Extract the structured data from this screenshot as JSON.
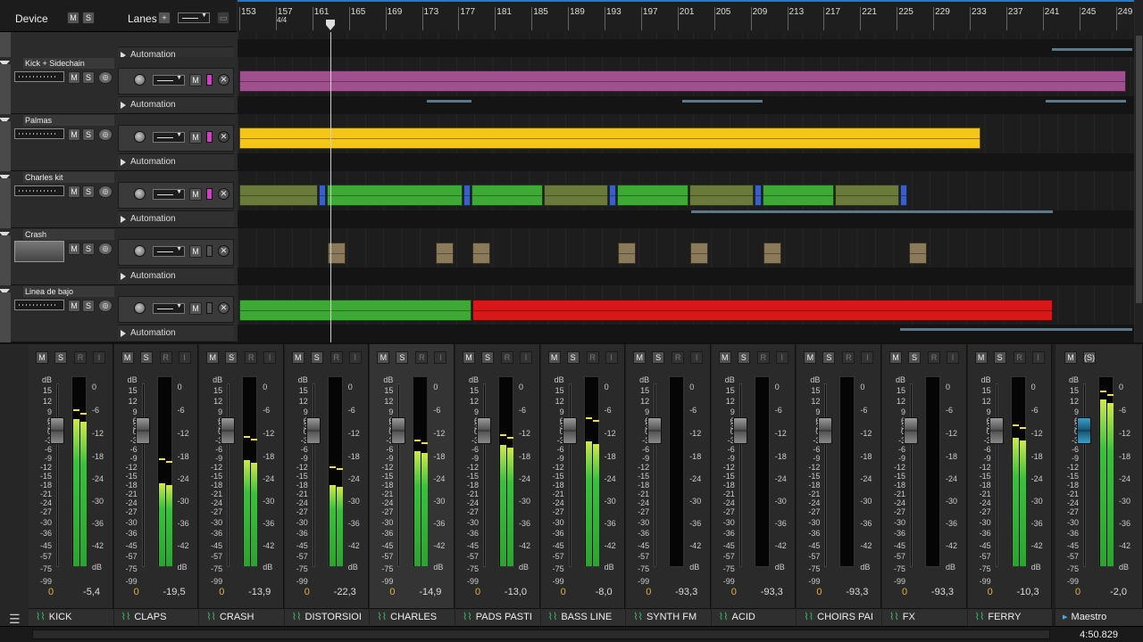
{
  "header": {
    "device_label": "Device",
    "m": "M",
    "s": "S",
    "lanes_label": "Lanes",
    "add": "+"
  },
  "ruler": {
    "time_signature": "4/4",
    "bars": [
      "153",
      "157",
      "161",
      "165",
      "169",
      "173",
      "177",
      "181",
      "185",
      "189",
      "193",
      "197",
      "201",
      "205",
      "209",
      "213",
      "217",
      "221",
      "225",
      "229",
      "233",
      "237",
      "241",
      "245",
      "249"
    ]
  },
  "tracks": [
    {
      "name": "",
      "automation": "Automation"
    },
    {
      "name": "Kick + Sidechain",
      "automation": "Automation"
    },
    {
      "name": "Palmas",
      "automation": "Automation"
    },
    {
      "name": "Charles kit",
      "automation": "Automation"
    },
    {
      "name": "Crash",
      "automation": "Automation"
    },
    {
      "name": "Linea de bajo",
      "automation": "Automation"
    }
  ],
  "colors": {
    "kick_clip": "#a0508f",
    "palmas_clip": "#f5c518",
    "charles_clip": "#3caa35",
    "charles_clip_alt": "#6a7a3a",
    "charles_marker": "#3a5fc8",
    "crash_clip": "#8a7a5a",
    "bajo_green": "#3caa35",
    "bajo_red": "#d81818",
    "meter_green": "#2aa530",
    "accent_blue": "#2a7ac0"
  },
  "mixer": {
    "msri": {
      "m": "M",
      "s": "S",
      "r": "R",
      "i": "I"
    },
    "scale_db_label": "dB",
    "left_scale": [
      "dB",
      "15",
      "12",
      "9",
      "6",
      "3",
      "0",
      "-3",
      "-6",
      "-9",
      "-12",
      "-15",
      "-18",
      "-21",
      "-24",
      "-27",
      "-30",
      "-36",
      "-45",
      "-57",
      "-75",
      "-99"
    ],
    "right_scale": [
      "0",
      "-6",
      "-12",
      "-18",
      "-24",
      "-30",
      "-36",
      "-42",
      "dB"
    ],
    "channels": [
      {
        "name": "KICK",
        "pan": "0",
        "level": "-5,4",
        "meter": 0.78,
        "peak": 0.82
      },
      {
        "name": "CLAPS",
        "pan": "0",
        "level": "-19,5",
        "meter": 0.44,
        "peak": 0.56
      },
      {
        "name": "CRASH",
        "pan": "0",
        "level": "-13,9",
        "meter": 0.56,
        "peak": 0.68
      },
      {
        "name": "DISTORSIOI",
        "pan": "0",
        "level": "-22,3",
        "meter": 0.43,
        "peak": 0.52
      },
      {
        "name": "CHARLES",
        "pan": "0",
        "level": "-14,9",
        "meter": 0.61,
        "peak": 0.66
      },
      {
        "name": "PADS PASTI",
        "pan": "0",
        "level": "-13,0",
        "meter": 0.64,
        "peak": 0.69
      },
      {
        "name": "BASS LINE",
        "pan": "0",
        "level": "-8,0",
        "meter": 0.66,
        "peak": 0.78
      },
      {
        "name": "SYNTH FM",
        "pan": "0",
        "level": "-93,3",
        "meter": 0.0,
        "peak": 0.0
      },
      {
        "name": "ACID",
        "pan": "0",
        "level": "-93,3",
        "meter": 0.0,
        "peak": 0.0
      },
      {
        "name": "CHOIRS PAI",
        "pan": "0",
        "level": "-93,3",
        "meter": 0.0,
        "peak": 0.0
      },
      {
        "name": "FX",
        "pan": "0",
        "level": "-93,3",
        "meter": 0.0,
        "peak": 0.0
      },
      {
        "name": "FERRY",
        "pan": "0",
        "level": "-10,3",
        "meter": 0.68,
        "peak": 0.74
      }
    ],
    "master": {
      "name": "Maestro",
      "pan": "0",
      "level": "-2,0",
      "meter": 0.88,
      "peak": 0.92,
      "m": "M",
      "s": "(S)"
    },
    "time": "4:50.829"
  }
}
